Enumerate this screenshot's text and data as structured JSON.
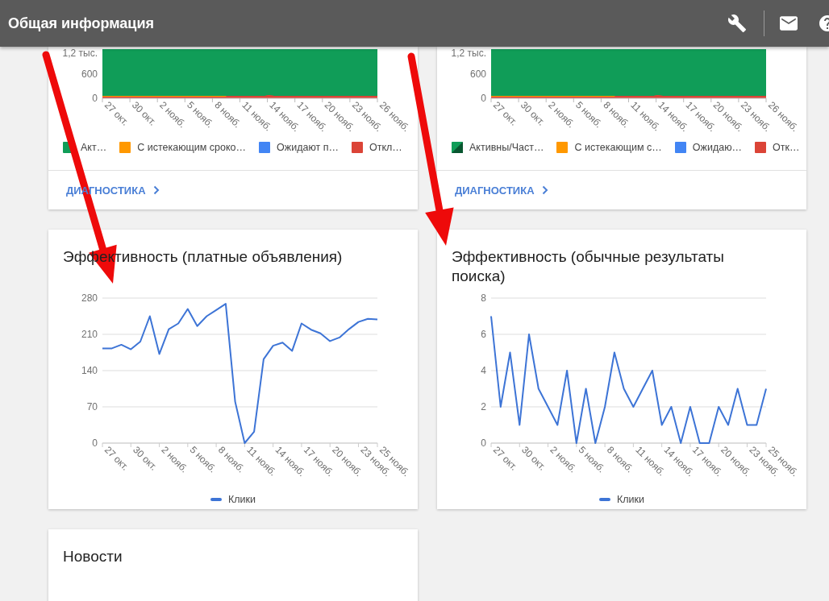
{
  "header": {
    "title": "Общая информация"
  },
  "cards": [
    {
      "kind": "status",
      "link": "ДИАГНОСТИКА",
      "chart": {
        "y_labels": [
          "1,2 тыс.",
          "600",
          "0"
        ],
        "x_labels": [
          "27 окт.",
          "30 окт.",
          "2 нояб.",
          "5 нояб.",
          "8 нояб.",
          "11 нояб.",
          "14 нояб.",
          "17 нояб.",
          "20 нояб.",
          "23 нояб.",
          "26 нояб."
        ],
        "legend": [
          {
            "label": "Акт…",
            "color": "#109d58",
            "kind": "solid"
          },
          {
            "label": "С истекающим сроко…",
            "color": "#ff9800",
            "kind": "solid"
          },
          {
            "label": "Ожидают п…",
            "color": "#4285f4",
            "kind": "solid"
          },
          {
            "label": "Откл…",
            "color": "#db4437",
            "kind": "solid"
          }
        ]
      }
    },
    {
      "kind": "status",
      "link": "ДИАГНОСТИКА",
      "chart": {
        "y_labels": [
          "1,2 тыс.",
          "600",
          "0"
        ],
        "x_labels": [
          "27 окт.",
          "30 окт.",
          "2 нояб.",
          "5 нояб.",
          "8 нояб.",
          "11 нояб.",
          "14 нояб.",
          "17 нояб.",
          "20 нояб.",
          "23 нояб.",
          "26 нояб."
        ],
        "legend": [
          {
            "label": "Активны/Част…",
            "color": "#109d58",
            "kind": "split"
          },
          {
            "label": "С истекающим с…",
            "color": "#ff9800",
            "kind": "solid"
          },
          {
            "label": "Ожидаю…",
            "color": "#4285f4",
            "kind": "solid"
          },
          {
            "label": "Отк…",
            "color": "#db4437",
            "kind": "solid"
          }
        ]
      }
    },
    {
      "kind": "performance",
      "chart_data": {
        "type": "line",
        "title": "Эффективность (платные объявления)",
        "categories": [
          "27 окт.",
          null,
          null,
          "30 окт.",
          null,
          null,
          "2 нояб.",
          null,
          null,
          "5 нояб.",
          null,
          null,
          "8 нояб.",
          null,
          null,
          "11 нояб.",
          null,
          null,
          "14 нояб.",
          null,
          null,
          "17 нояб.",
          null,
          null,
          "20 нояб.",
          null,
          null,
          "23 нояб.",
          null,
          "25 нояб."
        ],
        "ylim": [
          0,
          280
        ],
        "yticks": [
          0,
          70,
          140,
          210,
          280
        ],
        "grid": true,
        "series": [
          {
            "name": "Клики",
            "color": "#3d74d6",
            "values": [
              183,
              183,
              190,
              181,
              196,
              245,
              172,
              220,
              231,
              259,
              226,
              245,
              257,
              269,
              80,
              0,
              22,
              162,
              188,
              194,
              178,
              231,
              219,
              212,
              197,
              204,
              220,
              234,
              240,
              239
            ]
          }
        ]
      }
    },
    {
      "kind": "performance",
      "chart_data": {
        "type": "line",
        "title": "Эффективность (обычные результаты поиска)",
        "categories": [
          "27 окт.",
          null,
          null,
          "30 окт.",
          null,
          null,
          "2 нояб.",
          null,
          null,
          "5 нояб.",
          null,
          null,
          "8 нояб.",
          null,
          null,
          "11 нояб.",
          null,
          null,
          "14 нояб.",
          null,
          null,
          "17 нояб.",
          null,
          null,
          "20 нояб.",
          null,
          null,
          "23 нояб.",
          null,
          "25 нояб."
        ],
        "ylim": [
          0,
          8
        ],
        "yticks": [
          0,
          2,
          4,
          6,
          8
        ],
        "grid": true,
        "series": [
          {
            "name": "Клики",
            "color": "#3d74d6",
            "values": [
              7,
              2,
              5,
              1,
              6,
              3,
              2,
              1,
              4,
              0,
              3,
              0,
              2,
              5,
              3,
              2,
              3,
              4,
              1,
              2,
              0,
              2,
              0,
              0,
              2,
              1,
              3,
              1,
              1,
              3
            ]
          }
        ]
      }
    },
    {
      "kind": "news",
      "title": "Новости"
    }
  ]
}
